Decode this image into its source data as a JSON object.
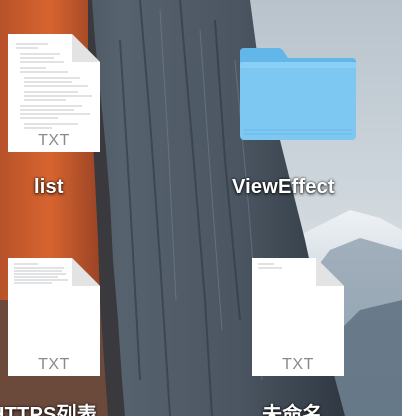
{
  "desktop": {
    "items": [
      {
        "name": "list",
        "type": "document",
        "ext": "TXT"
      },
      {
        "name": "ViewEffect",
        "type": "folder",
        "ext": ""
      },
      {
        "name": "HTTPS列表",
        "type": "document",
        "ext": "TXT"
      },
      {
        "name": "未命名",
        "type": "document",
        "ext": "TXT"
      }
    ]
  },
  "colors": {
    "folder_front": "#7cc8f2",
    "folder_back": "#63b6e8",
    "doc_page": "#ffffff",
    "label": "#ffffff"
  },
  "icons": {
    "document": "text-document-icon",
    "folder": "folder-icon"
  }
}
